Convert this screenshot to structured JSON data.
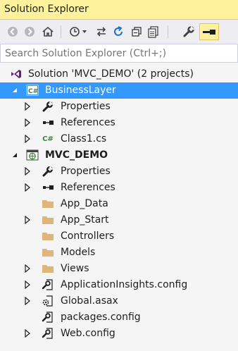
{
  "window": {
    "title": "Solution Explorer"
  },
  "search": {
    "placeholder": "Search Solution Explorer (Ctrl+;)"
  },
  "toolbar": {
    "buttons": [
      "back-icon",
      "forward-icon",
      "home-icon",
      "history-icon",
      "sync-icon",
      "refresh-icon",
      "collapse-all-icon",
      "show-all-files-icon",
      "properties-wrench-icon",
      "preview-selected-icon"
    ]
  },
  "tree": {
    "solution": "Solution 'MVC_DEMO' (2 projects)",
    "businessLayer": {
      "label": "BusinessLayer",
      "children": [
        "Properties",
        "References",
        "Class1.cs"
      ]
    },
    "mvcDemo": {
      "label": "MVC_DEMO",
      "children": [
        "Properties",
        "References",
        "App_Data",
        "App_Start",
        "Controllers",
        "Models",
        "Views",
        "ApplicationInsights.config",
        "Global.asax",
        "packages.config",
        "Web.config"
      ]
    },
    "cs_badge": "C#"
  },
  "colors": {
    "selection": "#3399ff",
    "title_bar": "#fff29d",
    "folder": "#dcb67a",
    "toolbar_bg": "#eeeef2"
  }
}
